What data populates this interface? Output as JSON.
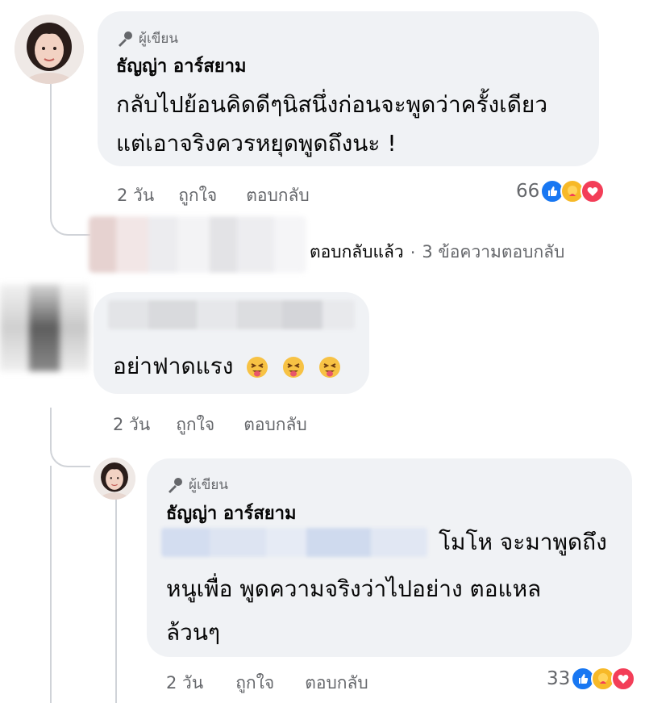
{
  "comment1": {
    "badge": "ผู้เขียน",
    "author": "ธัญญ่า อาร์สยาม",
    "lines": [
      "กลับไปย้อนคิดดีๆนิสนึ่งก่อนจะพูดว่าครั้งเดียว",
      "แต่เอาจริงควรหยุดพูดถึงนะ !"
    ],
    "time": "2 วัน",
    "like": "ถูกใจ",
    "reply": "ตอบกลับ",
    "reaction_count": "66",
    "reaction_icons": [
      "like-icon",
      "care-icon",
      "love-icon"
    ]
  },
  "replies_summary": {
    "replied_text": "ตอบกลับแล้ว",
    "separator": "·",
    "more_replies": "3 ข้อความตอบกลับ"
  },
  "comment2": {
    "text": "อย่าฟาดแรง",
    "emoji_icon": "squinting-tongue-emoji-icon",
    "time": "2 วัน",
    "like": "ถูกใจ",
    "reply": "ตอบกลับ"
  },
  "comment3": {
    "badge": "ผู้เขียน",
    "author": "ธัญญ่า อาร์สยาม",
    "line1": "โมโห จะมาพูดถึง",
    "line2": "หนูเพื่อ พูดความจริงว่าไปอย่าง ตอแหล",
    "line3": "ล้วนๆ",
    "time": "2 วัน",
    "like": "ถูกใจ",
    "reply": "ตอบกลับ",
    "reaction_count": "33",
    "reaction_icons": [
      "like-icon",
      "care-icon",
      "love-icon"
    ]
  },
  "colors": {
    "bubble": "#f0f2f5",
    "meta_text": "#65676b",
    "like_blue": "#1877f2",
    "love_red": "#f33e58",
    "care_yellow": "#f7b928"
  }
}
